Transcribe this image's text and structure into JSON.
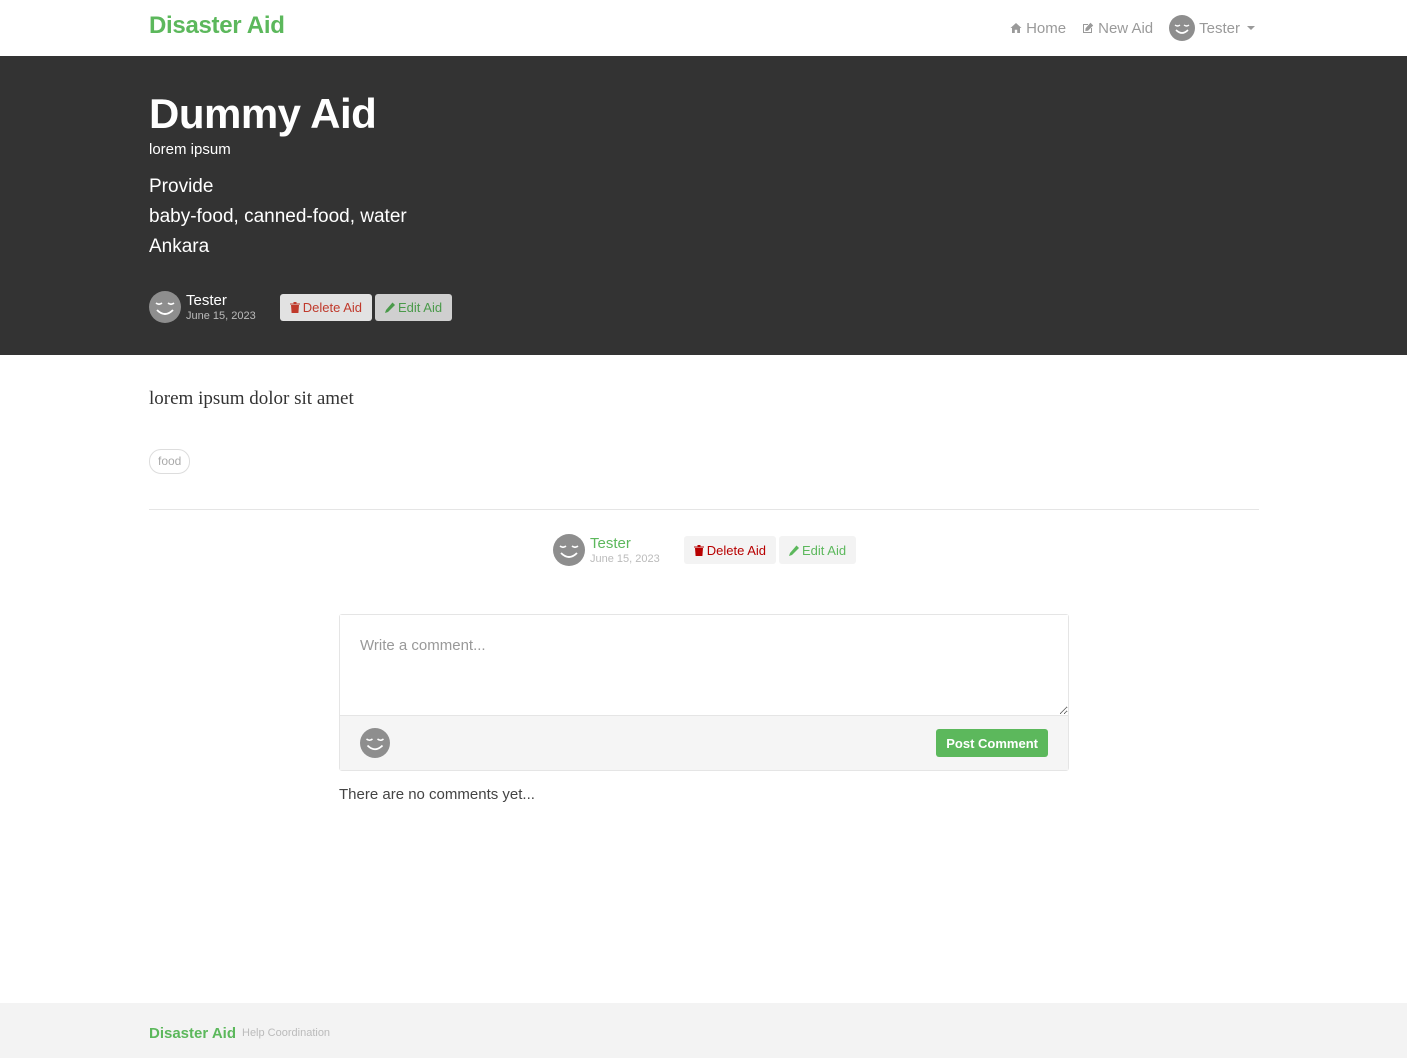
{
  "nav": {
    "brand": "Disaster Aid",
    "home_label": "Home",
    "new_aid_label": "New Aid",
    "user_label": "Tester"
  },
  "aid": {
    "title": "Dummy Aid",
    "subtitle": "lorem ipsum",
    "type": "Provide",
    "items": "baby-food, canned-food, water",
    "location": "Ankara",
    "author": "Tester",
    "date": "June 15, 2023",
    "delete_label": "Delete Aid",
    "edit_label": "Edit Aid",
    "body": "lorem ipsum dolor sit amet",
    "tags": [
      "food"
    ]
  },
  "comment_form": {
    "placeholder": "Write a comment...",
    "post_label": "Post Comment"
  },
  "comments": {
    "empty_text": "There are no comments yet..."
  },
  "footer": {
    "brand": "Disaster Aid",
    "tagline": "Help Coordination"
  },
  "colors": {
    "brand_green": "#5cb85c",
    "banner_bg": "#333333",
    "danger": "#b80000"
  }
}
